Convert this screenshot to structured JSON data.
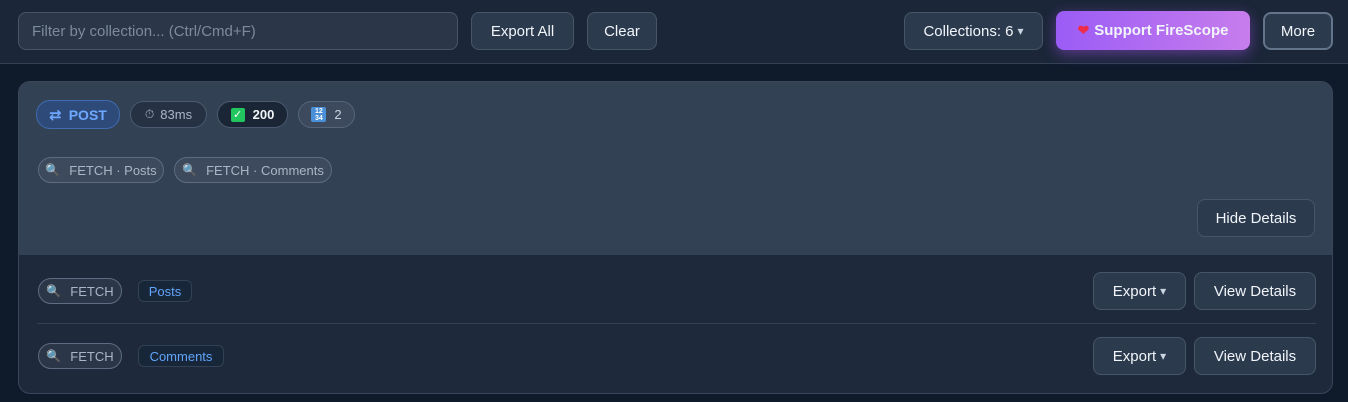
{
  "toolbar": {
    "filter_placeholder": "Filter by collection... (Ctrl/Cmd+F)",
    "export_all_label": "Export All",
    "clear_label": "Clear",
    "collections_label": "Collections: 6",
    "support_label": "Support FireScope",
    "more_label": "More"
  },
  "request": {
    "method": "POST",
    "duration": "83ms",
    "status": "200",
    "count": "2",
    "tags": [
      "FETCH · Posts",
      "FETCH · Comments"
    ],
    "hide_details_label": "Hide Details",
    "operations": [
      {
        "type": "FETCH",
        "collection": "Posts",
        "export_label": "Export",
        "view_label": "View Details"
      },
      {
        "type": "FETCH",
        "collection": "Comments",
        "export_label": "Export",
        "view_label": "View Details"
      }
    ]
  },
  "icons": {
    "method": "swap-arrows-icon",
    "duration": "stopwatch-icon",
    "status": "check-mark-icon",
    "count": "numbers-icon",
    "tag": "magnifier-icon",
    "support": "heart-icon"
  },
  "colors": {
    "method_text": "#6ea8ff",
    "support_gradient_start": "#9b5cf6",
    "support_gradient_end": "#c77dec",
    "status_ok": "#22c55e",
    "collection_link": "#60a5fa"
  }
}
